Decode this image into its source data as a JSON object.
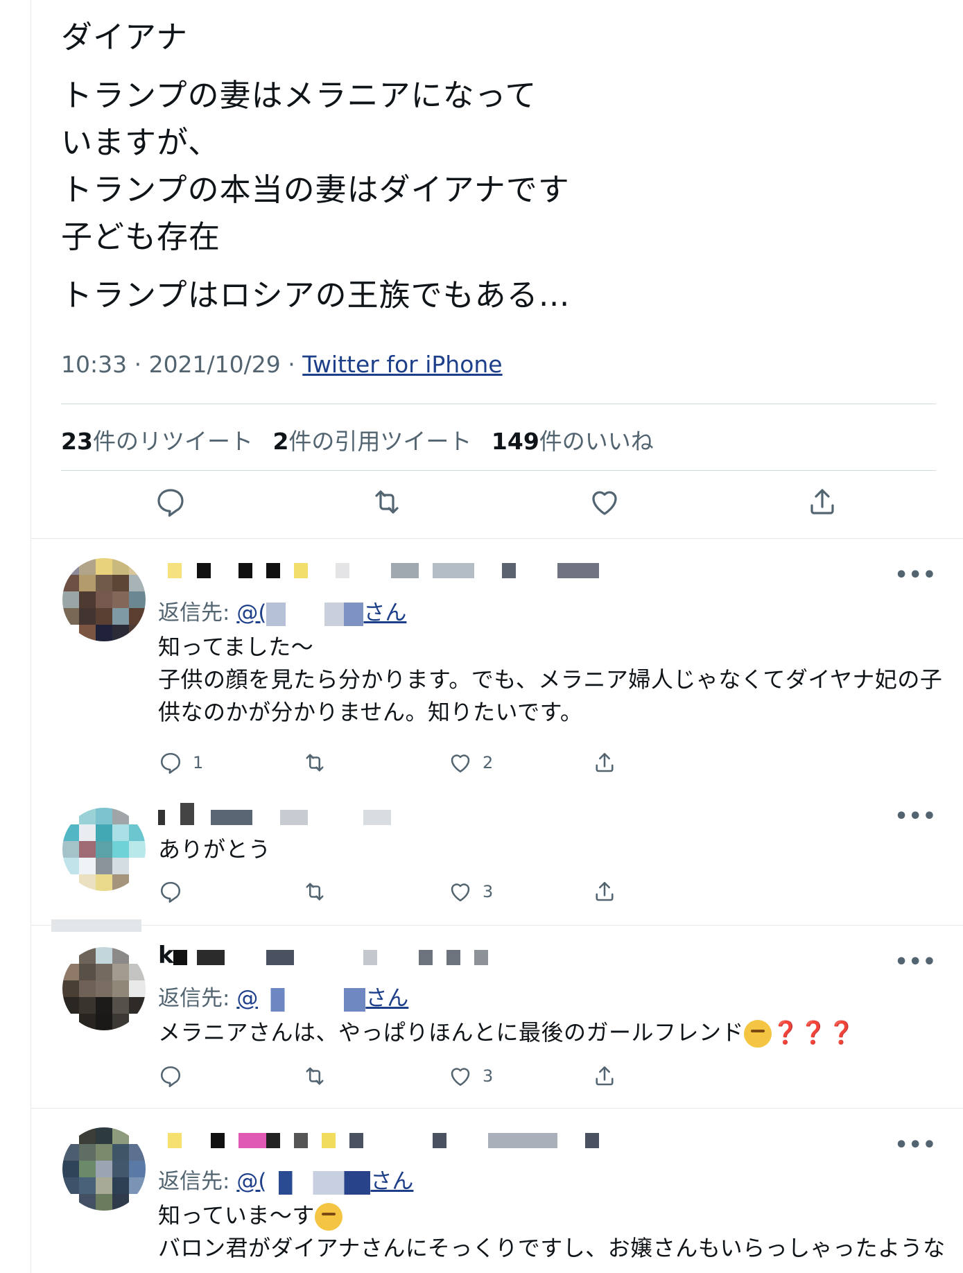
{
  "tweet": {
    "lines": [
      "ダイアナ",
      "トランプの妻はメラニアになって",
      "いますが、",
      "トランプの本当の妻はダイアナです",
      "子ども存在",
      "トランプはロシアの王族でもある…"
    ],
    "time": "10:33 · 2021/10/29 · ",
    "source": "Twitter for iPhone",
    "retweets_num": "23",
    "retweets_label": "件のリツイート",
    "quotes_num": "2",
    "quotes_label": "件の引用ツイート",
    "likes_num": "149",
    "likes_label": "件のいいね"
  },
  "replies": [
    {
      "replyto_prefix": "返信先: ",
      "replyto_handle": "@(",
      "replyto_suffix": "さん",
      "text_lines": [
        "知ってました〜",
        "子供の顔を見たら分かります。でも、メラニア婦人じゃなくてダイヤナ妃の子",
        "供なのかが分かりません。知りたいです。"
      ],
      "reply_count": "1",
      "retweet_count": "",
      "like_count": "2"
    },
    {
      "text_lines": [
        "ありがとう"
      ],
      "reply_count": "",
      "retweet_count": "",
      "like_count": "3"
    },
    {
      "name_initial": "k",
      "replyto_prefix": "返信先: ",
      "replyto_handle": "@",
      "replyto_suffix": "さん",
      "text_lines": [
        "メラニアさんは、やっぱりほんとに最後のガールフレンド"
      ],
      "qmarks": "❓❓❓",
      "reply_count": "",
      "retweet_count": "",
      "like_count": "3"
    },
    {
      "replyto_prefix": "返信先: ",
      "replyto_handle": "@(",
      "replyto_suffix": "さん",
      "text_lines": [
        "知っていま〜す",
        "バロン君がダイアナさんにそっくりですし、お嬢さんもいらっしゃったような"
      ]
    }
  ],
  "icons": {
    "reply": "reply-icon",
    "retweet": "retweet-icon",
    "like": "heart-icon",
    "share": "share-icon",
    "more": "more-icon"
  },
  "more_glyph": "•••",
  "colors": {
    "link": "#1d3f8a",
    "muted": "#536471",
    "divider": "#cfd9de"
  }
}
